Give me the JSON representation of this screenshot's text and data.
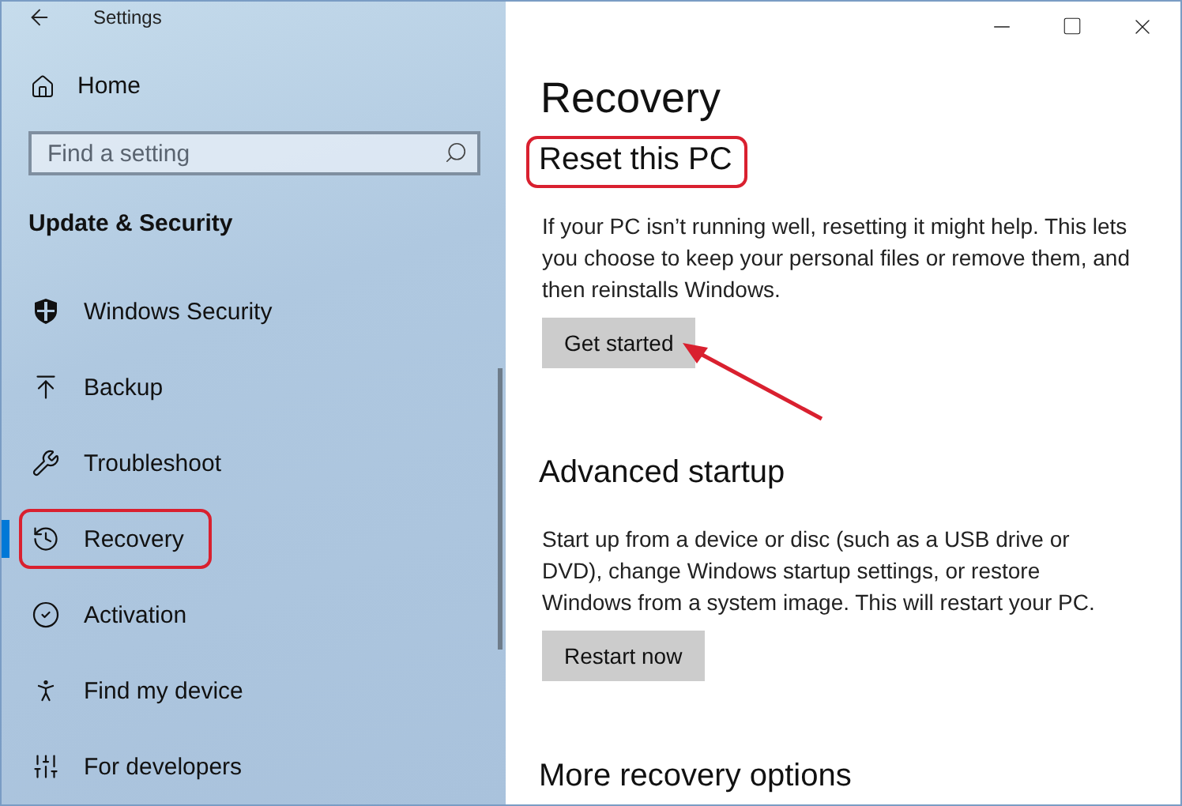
{
  "window": {
    "title": "Settings"
  },
  "sidebar": {
    "home": "Home",
    "search": {
      "placeholder": "Find a setting"
    },
    "section": "Update & Security",
    "items": [
      {
        "label": "Windows Security",
        "selected": false,
        "highlighted": false
      },
      {
        "label": "Backup",
        "selected": false,
        "highlighted": false
      },
      {
        "label": "Troubleshoot",
        "selected": false,
        "highlighted": false
      },
      {
        "label": "Recovery",
        "selected": true,
        "highlighted": true
      },
      {
        "label": "Activation",
        "selected": false,
        "highlighted": false
      },
      {
        "label": "Find my device",
        "selected": false,
        "highlighted": false
      },
      {
        "label": "For developers",
        "selected": false,
        "highlighted": false
      }
    ]
  },
  "content": {
    "title": "Recovery",
    "sections": [
      {
        "heading": "Reset this PC",
        "highlighted": true,
        "text": "If your PC isn’t running well, resetting it might help. This lets you choose to keep your personal files or remove them, and then reinstalls Windows.",
        "button": "Get started",
        "pointed_at": true
      },
      {
        "heading": "Advanced startup",
        "highlighted": false,
        "text": "Start up from a device or disc (such as a USB drive or DVD), change Windows startup settings, or restore Windows from a system image. This will restart your PC.",
        "button": "Restart now",
        "pointed_at": false
      },
      {
        "heading": "More recovery options",
        "highlighted": false
      }
    ]
  }
}
